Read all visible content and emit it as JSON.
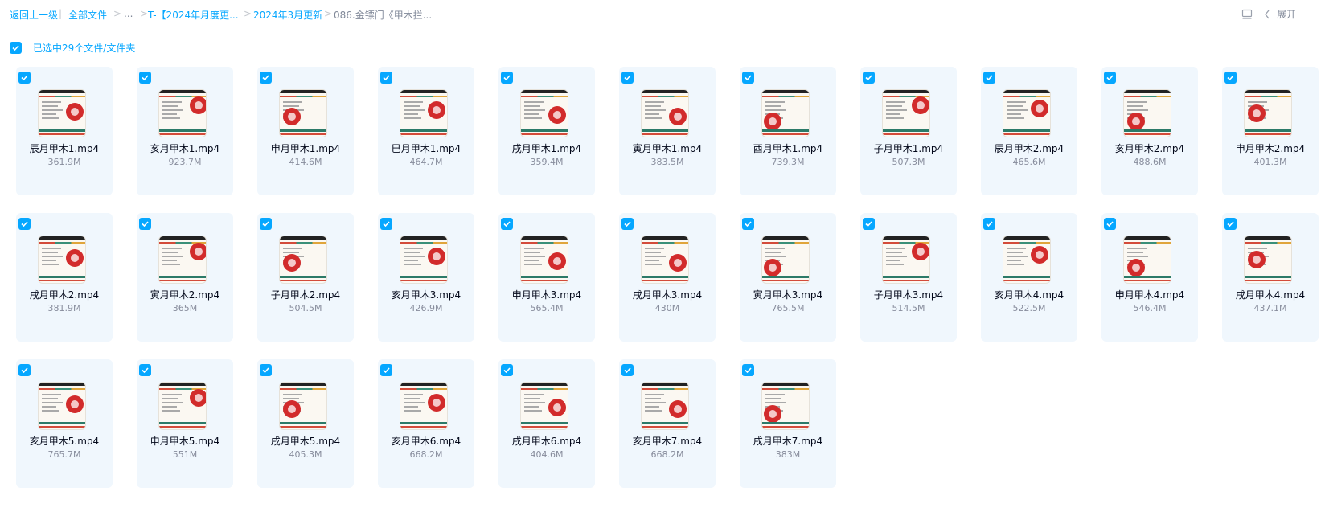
{
  "breadcrumb": {
    "back": "返回上一级",
    "divider": "|",
    "all_files": "全部文件",
    "ellipsis": "...",
    "folder1": "T-【2024年月度更...",
    "folder2": "2024年3月更新",
    "current": "086.金镖门《甲木拦...",
    "arrow": ">"
  },
  "toolbar": {
    "expand_label": "展开",
    "view_icon": "list-view-icon",
    "expand_icon": "chevron-left-icon"
  },
  "selection": {
    "text": "已选中29个文件/文件夹",
    "checked": true
  },
  "colors": {
    "accent": "#06a7ff",
    "card_bg": "#f0f7fd"
  },
  "files": [
    {
      "name": "辰月甲木1.mp4",
      "size": "361.9M",
      "checked": true
    },
    {
      "name": "亥月甲木1.mp4",
      "size": "923.7M",
      "checked": true
    },
    {
      "name": "申月甲木1.mp4",
      "size": "414.6M",
      "checked": true
    },
    {
      "name": "巳月甲木1.mp4",
      "size": "464.7M",
      "checked": true
    },
    {
      "name": "戌月甲木1.mp4",
      "size": "359.4M",
      "checked": true
    },
    {
      "name": "寅月甲木1.mp4",
      "size": "383.5M",
      "checked": true
    },
    {
      "name": "酉月甲木1.mp4",
      "size": "739.3M",
      "checked": true
    },
    {
      "name": "子月甲木1.mp4",
      "size": "507.3M",
      "checked": true
    },
    {
      "name": "辰月甲木2.mp4",
      "size": "465.6M",
      "checked": true
    },
    {
      "name": "亥月甲木2.mp4",
      "size": "488.6M",
      "checked": true
    },
    {
      "name": "申月甲木2.mp4",
      "size": "401.3M",
      "checked": true
    },
    {
      "name": "戌月甲木2.mp4",
      "size": "381.9M",
      "checked": true
    },
    {
      "name": "寅月甲木2.mp4",
      "size": "365M",
      "checked": true
    },
    {
      "name": "子月甲木2.mp4",
      "size": "504.5M",
      "checked": true
    },
    {
      "name": "亥月甲木3.mp4",
      "size": "426.9M",
      "checked": true
    },
    {
      "name": "申月甲木3.mp4",
      "size": "565.4M",
      "checked": true
    },
    {
      "name": "戌月甲木3.mp4",
      "size": "430M",
      "checked": true
    },
    {
      "name": "寅月甲木3.mp4",
      "size": "765.5M",
      "checked": true
    },
    {
      "name": "子月甲木3.mp4",
      "size": "514.5M",
      "checked": true
    },
    {
      "name": "亥月甲木4.mp4",
      "size": "522.5M",
      "checked": true
    },
    {
      "name": "申月甲木4.mp4",
      "size": "546.4M",
      "checked": true
    },
    {
      "name": "戌月甲木4.mp4",
      "size": "437.1M",
      "checked": true
    },
    {
      "name": "亥月甲木5.mp4",
      "size": "765.7M",
      "checked": true
    },
    {
      "name": "申月甲木5.mp4",
      "size": "551M",
      "checked": true
    },
    {
      "name": "戌月甲木5.mp4",
      "size": "405.3M",
      "checked": true
    },
    {
      "name": "亥月甲木6.mp4",
      "size": "668.2M",
      "checked": true
    },
    {
      "name": "戌月甲木6.mp4",
      "size": "404.6M",
      "checked": true
    },
    {
      "name": "亥月甲木7.mp4",
      "size": "668.2M",
      "checked": true
    },
    {
      "name": "戌月甲木7.mp4",
      "size": "383M",
      "checked": true
    }
  ]
}
